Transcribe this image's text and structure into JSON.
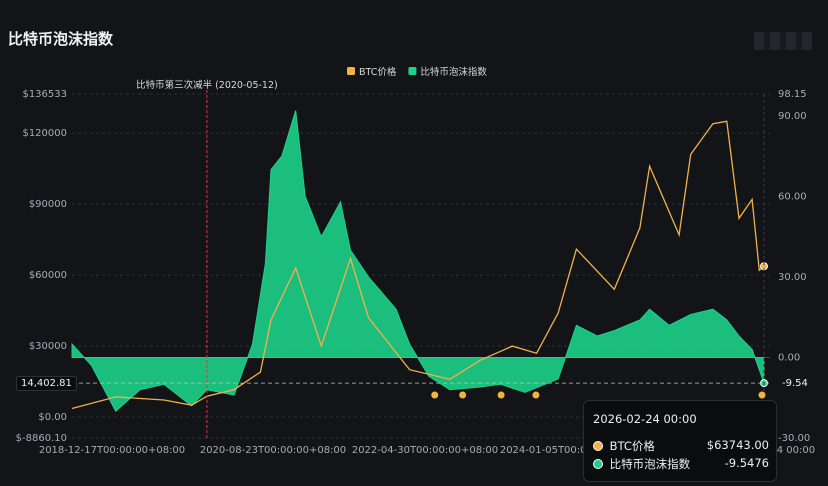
{
  "title": "比特币泡沫指数",
  "colors": {
    "btc": "#f0b14a",
    "bubble": "#1ed08a",
    "halving": "#e0333c",
    "grid": "#2c3038",
    "axis_text": "#a7abb3"
  },
  "chart_data": {
    "type": "line",
    "legend": [
      {
        "name": "BTC价格",
        "color": "#f0b14a"
      },
      {
        "name": "比特币泡沫指数",
        "color": "#1ed08a"
      }
    ],
    "legend_position": "top-center",
    "grid": true,
    "x_tick_labels": [
      "2018-12-17T00:00:00+08:00",
      "2020-08-23T00:00:00+08:00",
      "2022-04-30T00:00:00+08:00",
      "2024-01-05T00:00:00+08:00",
      "2026-02-24 00:00"
    ],
    "left_axis": {
      "ticks": [
        "$136533",
        "$120000",
        "$90000",
        "$60000",
        "$30000",
        "$0.00",
        "$-8860.10"
      ],
      "ylim": [
        -8860.1,
        136533
      ]
    },
    "right_axis": {
      "ticks": [
        "98.15",
        "90.00",
        "60.00",
        "30.00",
        "0.00",
        "-30.00"
      ],
      "ylim": [
        -30.0,
        98.15
      ]
    },
    "annotation": {
      "label": "比特币第三次减半 (2020-05-12)",
      "x": "2020-05-12"
    },
    "current_badge_left": "14,402.81",
    "current_badge_right": "-9.54",
    "series": [
      {
        "name": "BTC价格",
        "axis": "left",
        "x": [
          "2018-12-17",
          "2019-06-01",
          "2019-12-01",
          "2020-03-15",
          "2020-05-12",
          "2020-08-23",
          "2020-12-01",
          "2021-01-10",
          "2021-04-14",
          "2021-07-20",
          "2021-11-08",
          "2022-01-15",
          "2022-06-20",
          "2022-11-20",
          "2023-03-15",
          "2023-07-15",
          "2023-10-15",
          "2024-01-05",
          "2024-03-14",
          "2024-08-05",
          "2024-11-10",
          "2024-12-17",
          "2025-04-08",
          "2025-05-22",
          "2025-08-14",
          "2025-10-06",
          "2025-11-21",
          "2026-01-10",
          "2026-02-06",
          "2026-02-24"
        ],
        "values": [
          3600,
          8500,
          7200,
          5000,
          8800,
          11600,
          19000,
          41000,
          63000,
          30000,
          67000,
          42000,
          20000,
          16000,
          24000,
          30000,
          27000,
          44000,
          71000,
          54000,
          80000,
          106000,
          77000,
          111000,
          124000,
          125000,
          84000,
          92000,
          62000,
          63743
        ]
      },
      {
        "name": "比特币泡沫指数",
        "axis": "right",
        "x": [
          "2018-12-17",
          "2019-03-01",
          "2019-06-01",
          "2019-09-01",
          "2019-12-01",
          "2020-03-15",
          "2020-05-12",
          "2020-08-23",
          "2020-11-01",
          "2020-12-20",
          "2021-01-10",
          "2021-02-20",
          "2021-04-14",
          "2021-05-20",
          "2021-07-20",
          "2021-10-01",
          "2021-11-08",
          "2022-01-15",
          "2022-04-30",
          "2022-06-20",
          "2022-09-01",
          "2022-11-20",
          "2023-03-15",
          "2023-06-01",
          "2023-09-01",
          "2024-01-05",
          "2024-03-14",
          "2024-06-01",
          "2024-08-05",
          "2024-11-10",
          "2024-12-17",
          "2025-03-01",
          "2025-05-22",
          "2025-08-14",
          "2025-10-06",
          "2025-11-21",
          "2026-01-10",
          "2026-02-24"
        ],
        "values": [
          5,
          -3,
          -20,
          -12,
          -10,
          -18,
          -12,
          -14,
          5,
          35,
          70,
          75,
          92,
          60,
          45,
          58,
          40,
          30,
          18,
          5,
          -7,
          -12,
          -11,
          -10,
          -13,
          -8,
          12,
          8,
          10,
          14,
          18,
          12,
          16,
          18,
          14,
          8,
          3,
          -9.5476
        ]
      }
    ],
    "tooltip": {
      "date": "2026-02-24 00:00",
      "rows": [
        {
          "label": "BTC价格",
          "value": "$63743.00"
        },
        {
          "label": "比特币泡沫指数",
          "value": "-9.5476"
        }
      ]
    }
  }
}
